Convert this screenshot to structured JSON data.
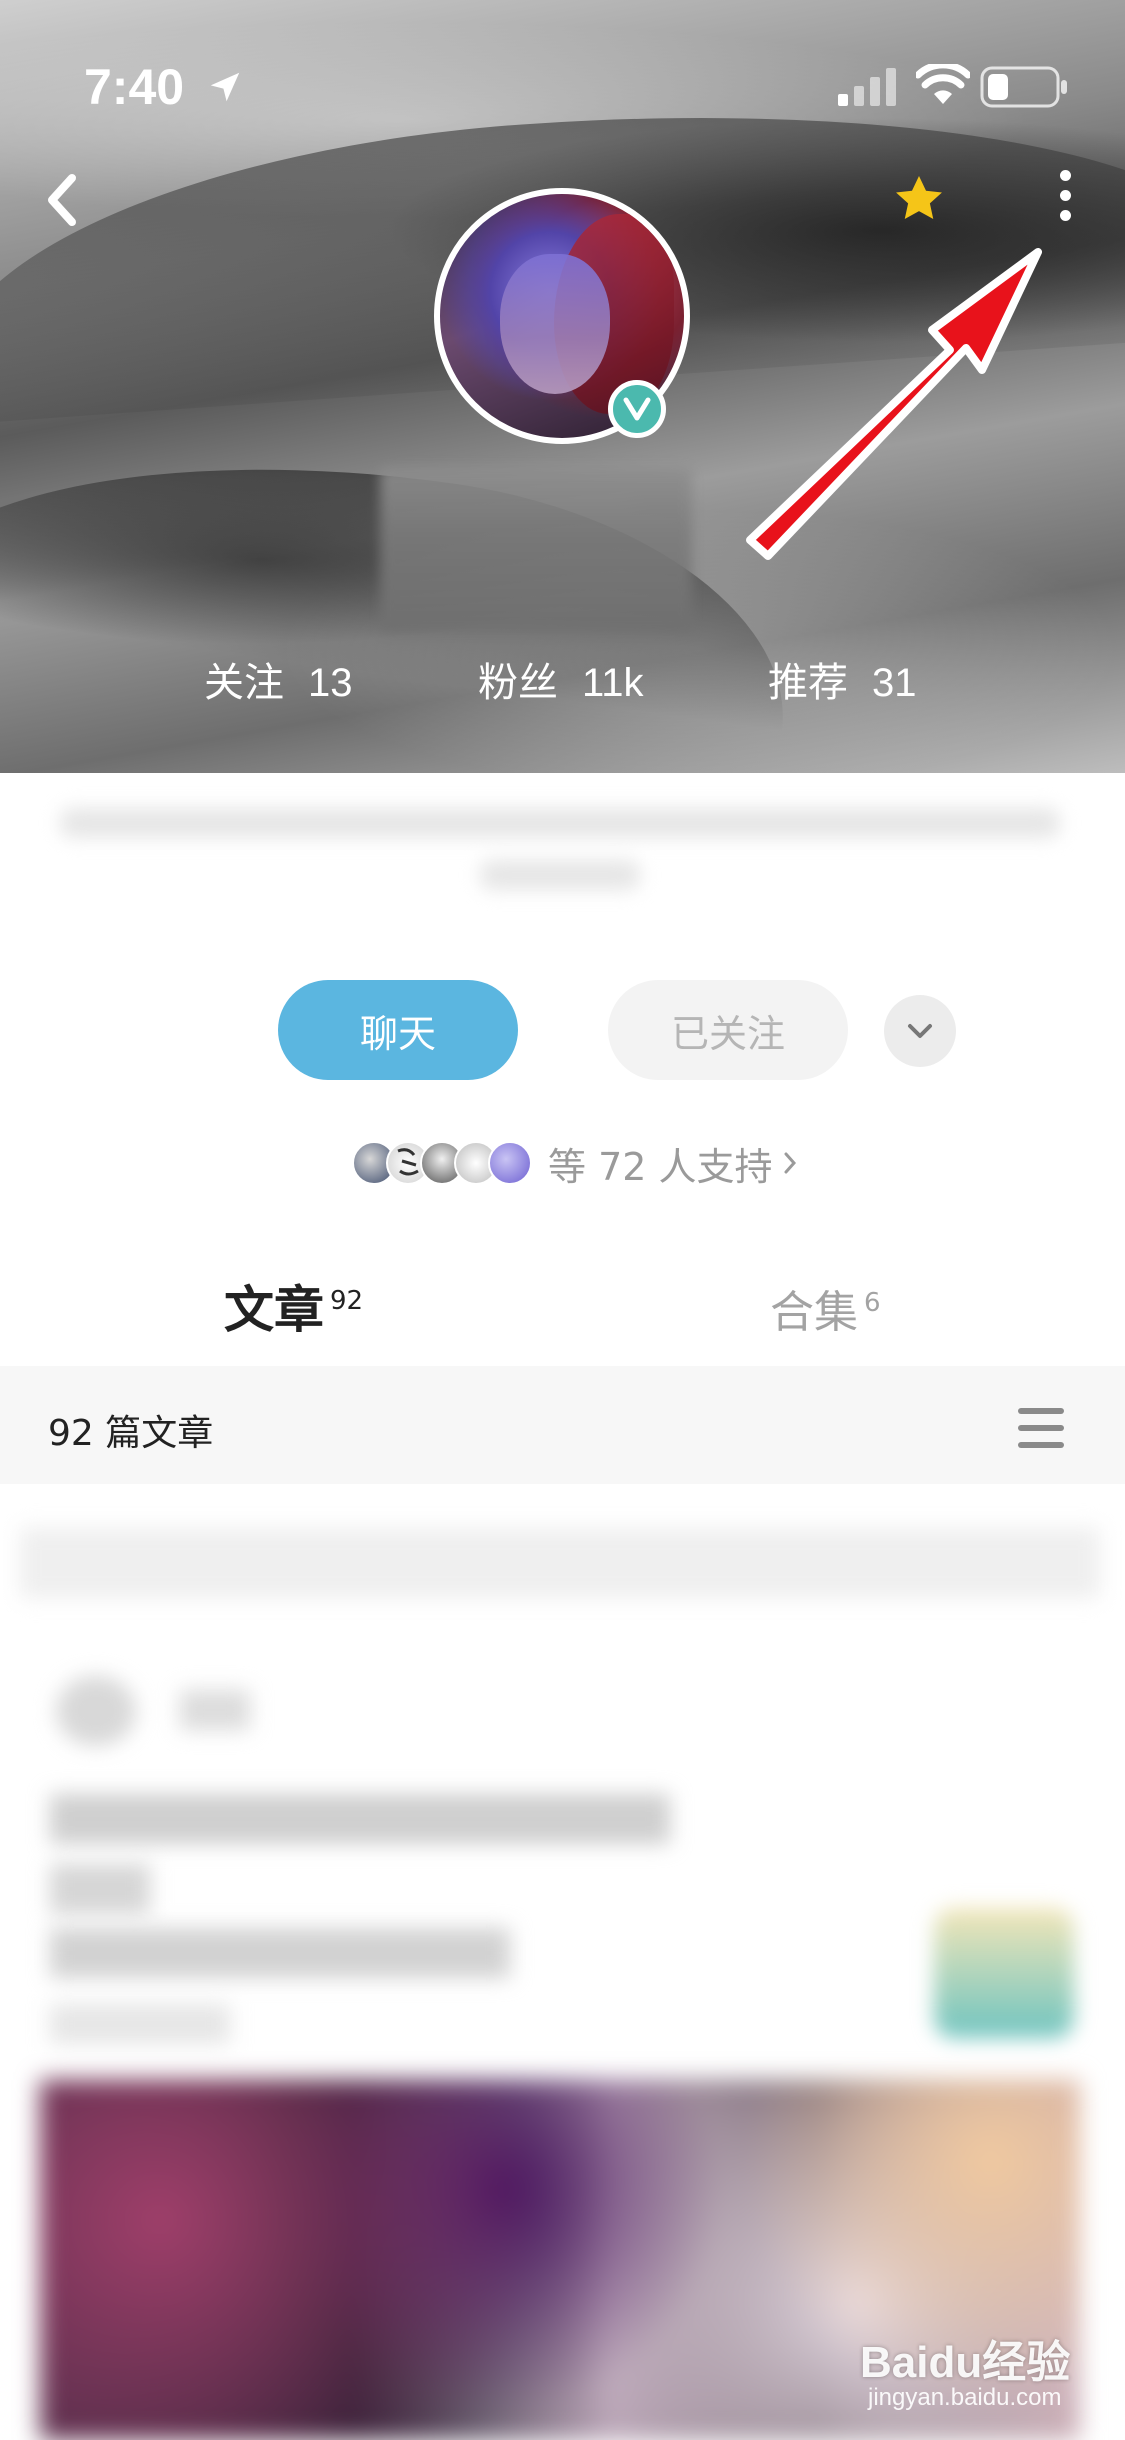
{
  "status_bar": {
    "time": "7:40"
  },
  "profile": {
    "stats": [
      {
        "label": "关注",
        "value": "13"
      },
      {
        "label": "粉丝",
        "value": "11k"
      },
      {
        "label": "推荐",
        "value": "31"
      }
    ],
    "verified": "V"
  },
  "actions": {
    "chat_label": "聊天",
    "followed_label": "已关注"
  },
  "supporters": {
    "text": "等 72 人支持"
  },
  "tabs": [
    {
      "label": "文章",
      "count": "92"
    },
    {
      "label": "合集",
      "count": "6"
    }
  ],
  "list": {
    "count_text": "92 篇文章"
  },
  "watermark": {
    "brand": "Baidu经验",
    "url": "jingyan.baidu.com"
  },
  "colors": {
    "chat_button": "#5bb6e0",
    "verified_badge": "#4bb9ae",
    "star": "#f5c518",
    "annotation_arrow": "#e8121b"
  }
}
